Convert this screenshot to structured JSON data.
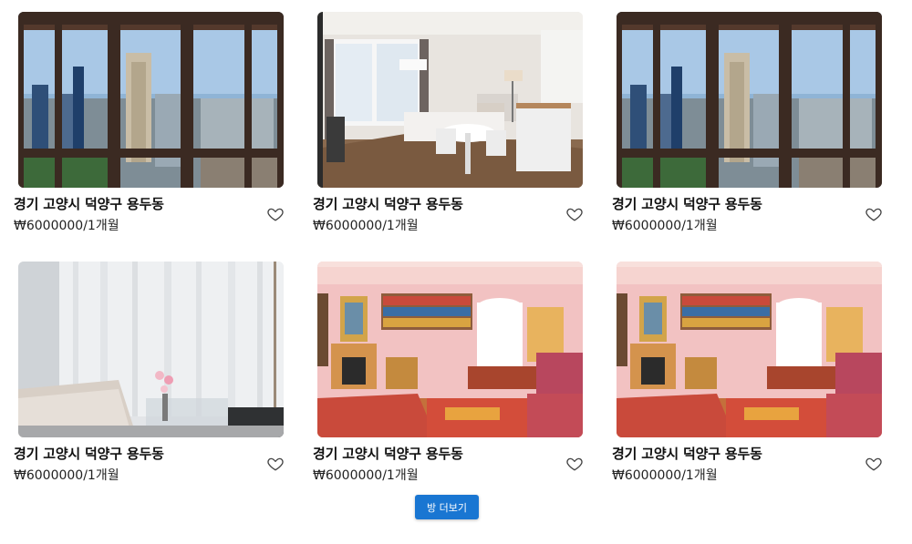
{
  "listings": [
    {
      "title": "경기 고양시 덕양구 용두동",
      "price": "₩6000000/1개월",
      "photo": "city-view-window-photo",
      "favorite_icon": "heart-outline-icon"
    },
    {
      "title": "경기 고양시 덕양구 용두동",
      "price": "₩6000000/1개월",
      "photo": "studio-room-photo",
      "favorite_icon": "heart-outline-icon"
    },
    {
      "title": "경기 고양시 덕양구 용두동",
      "price": "₩6000000/1개월",
      "photo": "city-view-window-photo",
      "favorite_icon": "heart-outline-icon"
    },
    {
      "title": "경기 고양시 덕양구 용두동",
      "price": "₩6000000/1개월",
      "photo": "white-curtain-bedroom-photo",
      "favorite_icon": "heart-outline-icon"
    },
    {
      "title": "경기 고양시 덕양구 용두동",
      "price": "₩6000000/1개월",
      "photo": "pink-living-room-photo",
      "favorite_icon": "heart-outline-icon"
    },
    {
      "title": "경기 고양시 덕양구 용두동",
      "price": "₩6000000/1개월",
      "photo": "pink-living-room-photo",
      "favorite_icon": "heart-outline-icon"
    }
  ],
  "more_button": {
    "label": "방 더보기"
  },
  "colors": {
    "accent": "#1976d2",
    "text": "#111111"
  }
}
